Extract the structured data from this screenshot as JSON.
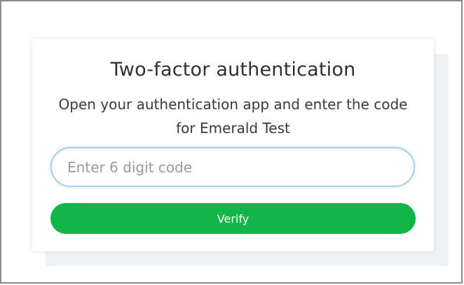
{
  "dialog": {
    "title": "Two-factor authentication",
    "subtitle": "Open your authentication app and enter the code for Emerald Test",
    "code_input": {
      "value": "",
      "placeholder": "Enter 6 digit code"
    },
    "verify_label": "Verify"
  },
  "colors": {
    "accent": "#11b54a",
    "input_border": "#a9d3e2"
  }
}
